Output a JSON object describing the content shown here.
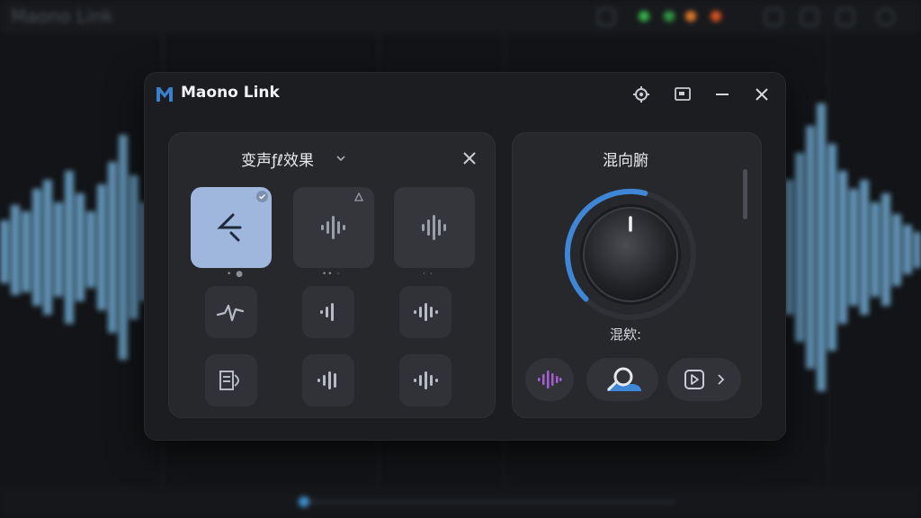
{
  "background": {
    "title": "Maono Link",
    "accent_wave": "#7fb3d6",
    "status_colors": [
      "#35b34a",
      "#e0782a",
      "#d9531f"
    ]
  },
  "window": {
    "app_title": "Maono Link",
    "controls": [
      "gear-icon",
      "screen-icon",
      "minimize-icon",
      "close-icon"
    ]
  },
  "voice_panel": {
    "title": "变声ƒℓ效果",
    "presets": [
      {
        "id": "preset-1",
        "icon": "pitch-line-icon",
        "selected": true,
        "dots": "•  ●"
      },
      {
        "id": "preset-2",
        "icon": "waveform-icon",
        "selected": false,
        "dots": "•• ·"
      },
      {
        "id": "preset-3",
        "icon": "waveform-icon",
        "selected": false,
        "dots": "· ·"
      },
      {
        "id": "preset-4",
        "icon": "zigzag-icon",
        "selected": false
      },
      {
        "id": "preset-5",
        "icon": "waveform-icon",
        "selected": false
      },
      {
        "id": "preset-6",
        "icon": "waveform-icon",
        "selected": false
      },
      {
        "id": "preset-7",
        "icon": "voice-box-icon",
        "selected": false
      },
      {
        "id": "preset-8",
        "icon": "waveform-icon",
        "selected": false
      },
      {
        "id": "preset-9",
        "icon": "waveform-icon",
        "selected": false
      }
    ]
  },
  "mix_panel": {
    "title": "混向腑",
    "label": "混欸:",
    "knob_value": 0.55,
    "accent": "#3f86d6",
    "buttons": [
      "purple-wave-icon",
      "headset-icon",
      "play-box-icon"
    ]
  }
}
